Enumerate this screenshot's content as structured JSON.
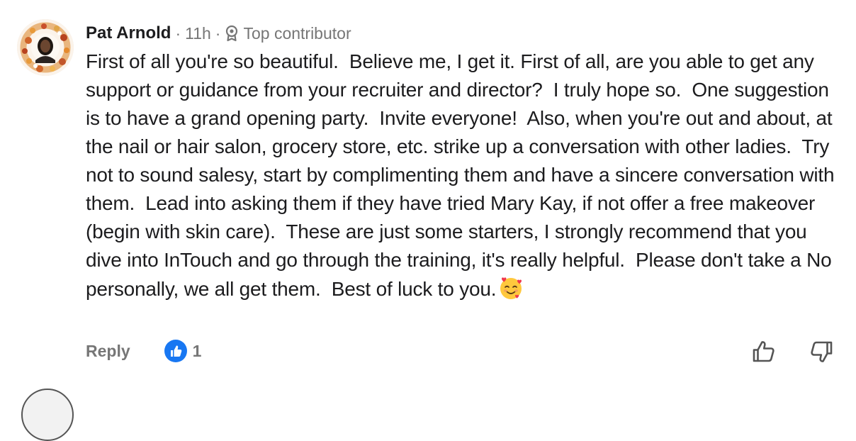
{
  "comment": {
    "author": "Pat Arnold",
    "time": "11h",
    "separator": "·",
    "badge": "Top contributor",
    "badge_icon": "award-icon",
    "text": "First of all you're so beautiful.  Believe me, I get it. First of all, are you able to get any support or guidance from your recruiter and director?  I truly hope so.  One suggestion is to have a grand opening party.  Invite everyone!  Also, when you're out and about, at the nail or hair salon, grocery store, etc. strike up a conversation with other ladies.  Try not to sound salesy, start by complimenting them and have a sincere conversation with them.  Lead into asking them if they have tried Mary Kay, if not offer a free makeover (begin with skin care).  These are just some starters, I strongly recommend that you dive into InTouch and go through the training, it's really helpful.  Please don't take a No personally, we all get them.  Best of luck to you.",
    "emoji": "smiling-face-with-hearts-icon"
  },
  "actions": {
    "reply_label": "Reply",
    "reaction_icon": "like-icon",
    "reaction_count": "1",
    "upvote_icon": "thumbs-up-outline-icon",
    "downvote_icon": "thumbs-down-outline-icon"
  },
  "colors": {
    "text": "#1c1c1e",
    "meta": "#767676",
    "like_blue": "#1877f2"
  }
}
